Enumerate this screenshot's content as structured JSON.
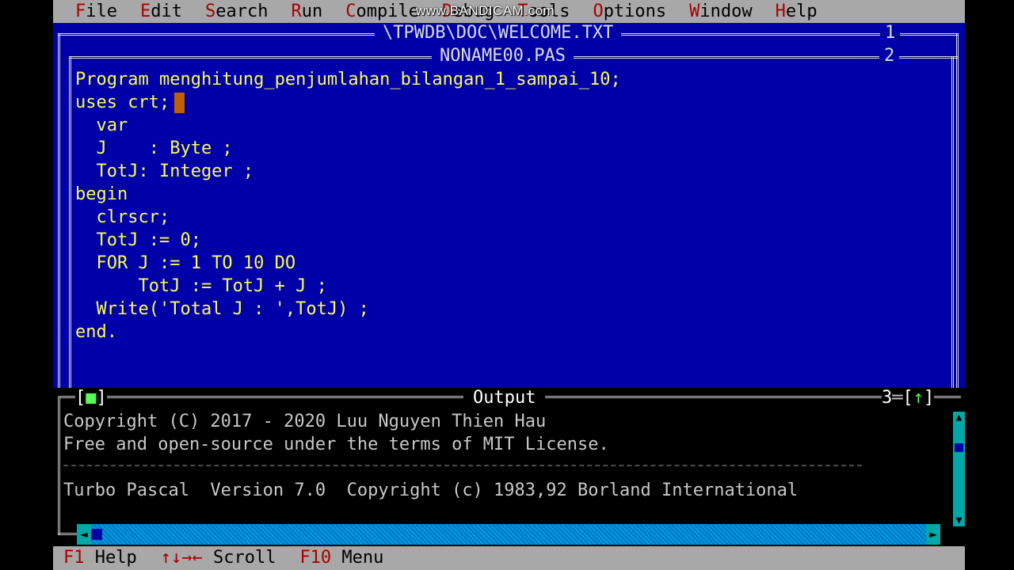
{
  "menu": [
    {
      "hot": "F",
      "rest": "ile"
    },
    {
      "hot": "E",
      "rest": "dit"
    },
    {
      "hot": "S",
      "rest": "earch"
    },
    {
      "hot": "R",
      "rest": "un"
    },
    {
      "hot": "C",
      "rest": "ompile"
    },
    {
      "hot": "D",
      "rest": "ebug"
    },
    {
      "hot": "T",
      "rest": "ools"
    },
    {
      "hot": "O",
      "rest": "ptions"
    },
    {
      "hot": "W",
      "rest": "indow"
    },
    {
      "hot": "H",
      "rest": "elp"
    }
  ],
  "watermark": "www.BANDICAM.com",
  "window1": {
    "title": "\\TPWDB\\DOC\\WELCOME.TXT",
    "number": "1"
  },
  "window2": {
    "title": "NONAME00.PAS",
    "number": "2"
  },
  "editor": {
    "lines": [
      "Program menghitung_penjumlahan_bilangan_1_sampai_10;",
      "uses crt;",
      "  var",
      "  J    : Byte ;",
      "  TotJ: Integer ;",
      "begin",
      "  clrscr;",
      "  TotJ := 0;",
      "  FOR J := 1 TO 10 DO",
      "      TotJ := TotJ + J ;",
      "  Write('Total J : ',TotJ) ;",
      "end."
    ]
  },
  "output": {
    "title": "Output",
    "close_open": "[",
    "close_mark": "■",
    "close_close": "]",
    "number": "3",
    "zoom_open": "[",
    "zoom_mark": "↑",
    "zoom_close": "]",
    "lines": [
      "Copyright (C) 2017 - 2020 Luu Nguyen Thien Hau",
      "Free and open-source under the terms of MIT License."
    ],
    "lines2": [
      "Turbo Pascal  Version 7.0  Copyright (c) 1983,92 Borland International"
    ]
  },
  "status": [
    {
      "key": "F1",
      "label": " Help"
    },
    {
      "key": "↑↓→←",
      "label": " Scroll"
    },
    {
      "key": "F10",
      "label": " Menu"
    }
  ],
  "colors": {
    "desktop": "#0000a8",
    "code_text": "#fcfc54",
    "menu_bg": "#a8a8a8",
    "hotkey": "#a80000",
    "cursor": "#c06000"
  }
}
